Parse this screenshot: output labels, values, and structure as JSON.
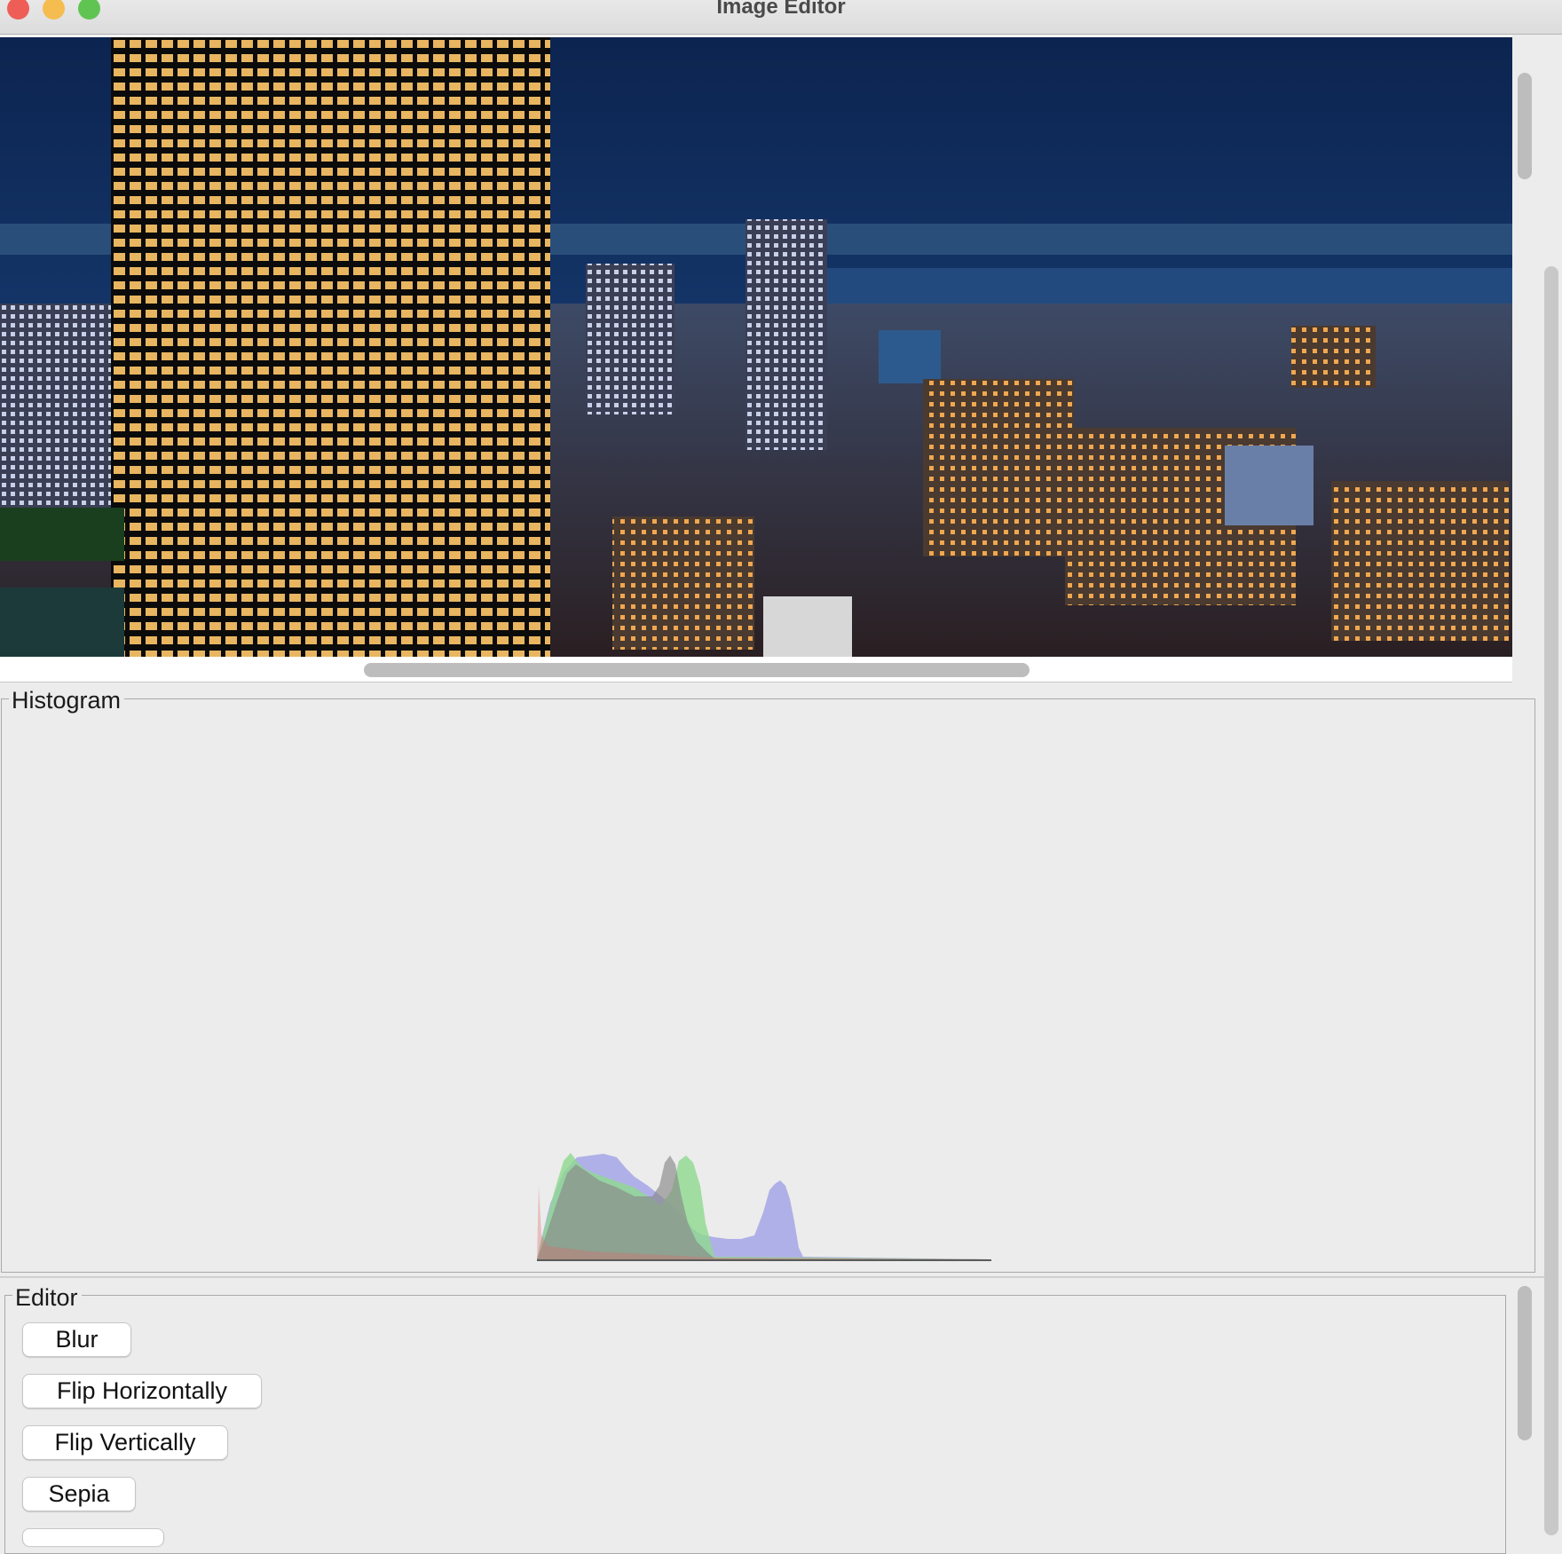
{
  "window": {
    "title": "Image Editor"
  },
  "histogram": {
    "title": "Histogram",
    "colors": {
      "red": "#e06a6a",
      "green": "#8fd98f",
      "blue": "#a6a6e8",
      "gray": "#888888"
    }
  },
  "editor": {
    "title": "Editor",
    "buttons": [
      "Blur",
      "Flip Horizontally",
      "Flip Vertically",
      "Sepia"
    ]
  }
}
